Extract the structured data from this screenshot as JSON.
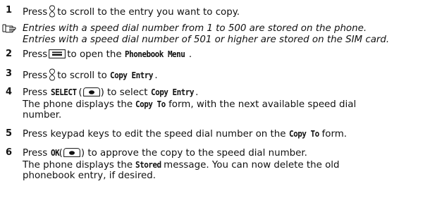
{
  "steps": [
    {
      "num": "1",
      "line1_a": "Press",
      "line1_b": "to scroll to the entry you want to copy."
    },
    {
      "note_line1": "Entries with a speed dial number from 1 to 500 are stored on the phone.",
      "note_line2": "Entries with a speed dial number of 501 or higher are stored on the SIM card."
    },
    {
      "num": "2",
      "line1_a": "Press",
      "line1_b": "to open the",
      "kw": "Phonebook Menu",
      "line1_c": "."
    },
    {
      "num": "3",
      "line1_a": "Press",
      "line1_b": "to scroll to",
      "kw": "Copy Entry",
      "line1_c": "."
    },
    {
      "num": "4",
      "line1_a": "Press",
      "kw_key": "SELECT",
      "paren_open": "(",
      "paren_close": ") to select",
      "kw": "Copy Entry",
      "line1_c": ".",
      "line2_a": "The phone displays the",
      "kw2": "Copy To",
      "line2_b": "form, with the next available speed dial",
      "line3": "number."
    },
    {
      "num": "5",
      "line1_a": "Press keypad keys to edit the speed dial number on the",
      "kw": "Copy To",
      "line1_b": "form."
    },
    {
      "num": "6",
      "line1_a": "Press",
      "kw_key": "OK",
      "paren_open": "(",
      "paren_close": ") to approve the copy to the speed dial number.",
      "line2_a": "The phone displays the",
      "kw2": "Stored",
      "line2_b": "message. You can now delete the old",
      "line3": "phonebook entry, if desired."
    }
  ],
  "icons": {
    "scroll": "scroll-key-icon",
    "menu": "menu-key-icon",
    "soft": "soft-key-icon",
    "note": "note-hand-icon"
  }
}
